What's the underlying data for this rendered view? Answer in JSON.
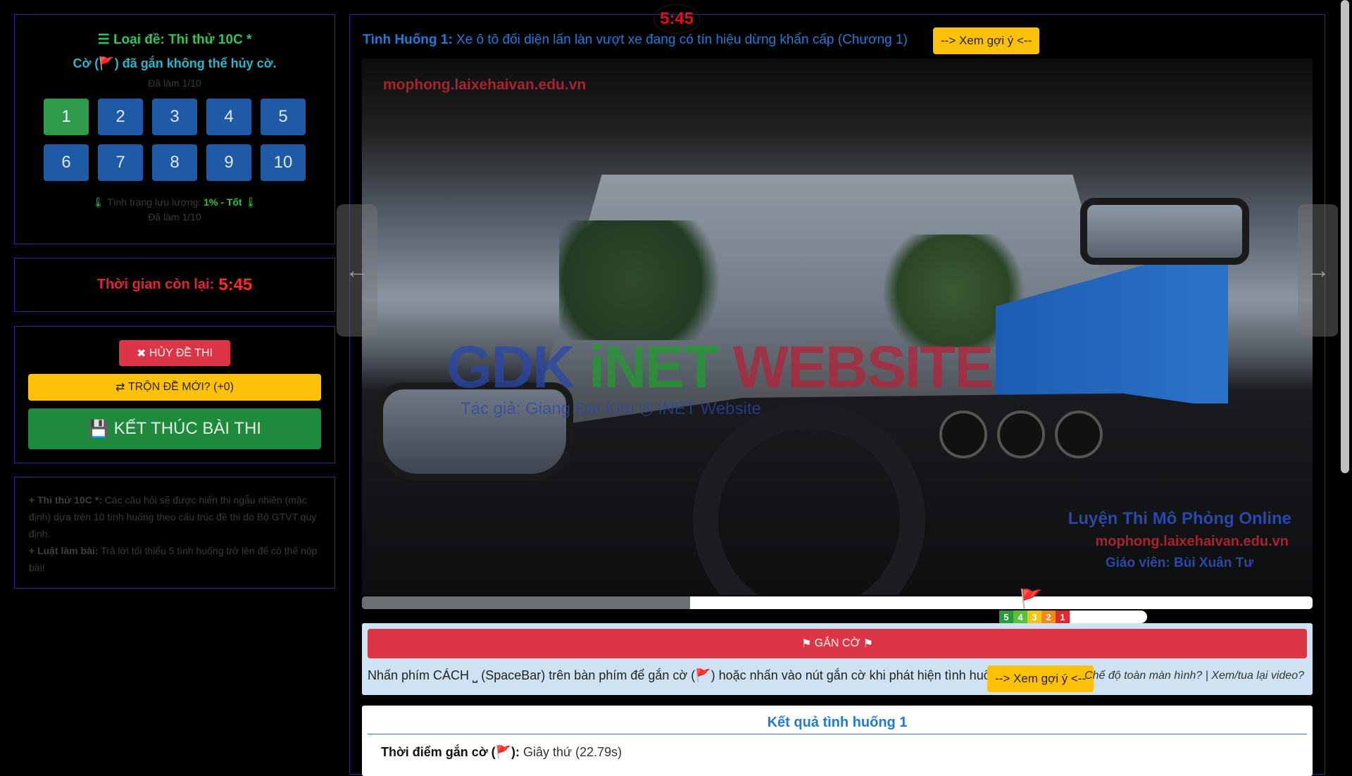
{
  "exam": {
    "type_label": "Loại đề: Thi thử 10C *",
    "flag_note": "Cờ (🚩) đã gắn không thể hủy cờ.",
    "done_count": "Đã làm 1/10",
    "questions": [
      "1",
      "2",
      "3",
      "4",
      "5",
      "6",
      "7",
      "8",
      "9",
      "10"
    ],
    "active_question": "1",
    "storage_label": "Tình trạng lưu lượng:",
    "storage_value": "1% - Tốt",
    "done_count_bottom": "Đã làm 1/10"
  },
  "timer": {
    "label": "Thời gian còn lại:",
    "value": "5:45",
    "bubble": "5:45"
  },
  "actions": {
    "cancel": "HỦY ĐỀ THI",
    "shuffle": "TRỘN ĐỀ MỚI? (+0)",
    "finish": "KẾT THÚC BÀI THI"
  },
  "info": {
    "line1_bold": "+ Thi thử 10C *:",
    "line1_text": " Các câu hỏi sẽ được hiển thị ngẫu nhiên (mặc định) dựa trên 10 tình huống theo cấu trúc đề thi do Bộ GTVT quy định.",
    "line2_bold": "+ Luật làm bài:",
    "line2_text": " Trả lời tối thiểu 5 tình huống trở lên để có thể nộp bài!"
  },
  "question": {
    "label": "Tình Huống 1:",
    "text": "Xe ô tô đối diện lấn làn vượt xe đang có tín hiệu dừng khẩn cấp (Chương 1)",
    "hint_button": "--> Xem gợi ý <--"
  },
  "video": {
    "watermark_top": "mophong.laixehaivan.edu.vn",
    "wm_big_1": "GDK ",
    "wm_big_2": "iNET ",
    "wm_big_3": "WEBSITE",
    "wm_sub": "Tác giả: Giang Đại Kim ◎ iNET Website",
    "wm_br1": "Luyện Thi Mô Phỏng Online",
    "wm_br2": "mophong.laixehaivan.edu.vn",
    "wm_br3": "Giáo viên: Bùi Xuân Tư",
    "progress_fraction": 0.345
  },
  "score_bar": {
    "labels": [
      "5",
      "4",
      "3",
      "2",
      "1"
    ],
    "colors": [
      "#2a9a3a",
      "#5cbf3a",
      "#f0c419",
      "#f08a1c",
      "#e22a2a"
    ]
  },
  "flag": {
    "button": "GẮN CỜ",
    "instruction": "Nhấn phím CÁCH ⎵ (SpaceBar) trên bàn phím để gắn cờ (🚩) hoặc nhấn vào nút gắn cờ khi phát hiện tình huống.",
    "hint_button": "--> Xem gợi ý <--",
    "link_fullscreen": "Chế độ toàn màn hình?",
    "link_separator": " | ",
    "link_replay": "Xem/tua lại video?"
  },
  "result": {
    "title": "Kết quả tình huống 1",
    "flag_time_label": "Thời điểm gắn cờ (🚩):",
    "flag_time_value": " Giây thứ (22.79s)"
  },
  "colors": {
    "accent_blue": "#1f7bd8",
    "danger": "#dc3545",
    "warning": "#ffc107",
    "success": "#1f8a3b"
  }
}
